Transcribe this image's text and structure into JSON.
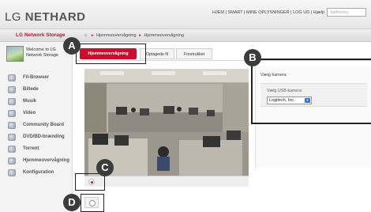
{
  "header": {
    "logo_lg": "LG ",
    "logo_nethard": "NETHARD",
    "top_nav": "HJEM | SMART | MINE OPLYSNINGER | LOG UD | Hjælp",
    "search_placeholder": "Søfthering"
  },
  "strip": {
    "brand": "LG Network Storage",
    "breadcrumb_1": "Hjemmeovervågning",
    "breadcrumb_2": "Hjemmeovervågning"
  },
  "sidebar": {
    "welcome_line1": "Welcome to LG",
    "welcome_line2": "Network Storage",
    "items": [
      {
        "label": "Fil-Browser"
      },
      {
        "label": "Billede"
      },
      {
        "label": "Musik"
      },
      {
        "label": "Video"
      },
      {
        "label": "Community Board"
      },
      {
        "label": "DVD/BD-brænding"
      },
      {
        "label": "Torrent"
      },
      {
        "label": "Hjemmeovervågning"
      },
      {
        "label": "Konfiguration"
      }
    ]
  },
  "tabs": [
    {
      "label": "Hjemmeovervågning"
    },
    {
      "label": "Optagede fil"
    },
    {
      "label": "Foretrukket"
    }
  ],
  "camera_panel": {
    "title": "Vælg kamera",
    "usb_label": "Vælg USB-kamera",
    "selected_camera": "Logitech, Inc."
  },
  "callouts": {
    "a": "A",
    "b": "B",
    "c": "C",
    "d": "D"
  }
}
